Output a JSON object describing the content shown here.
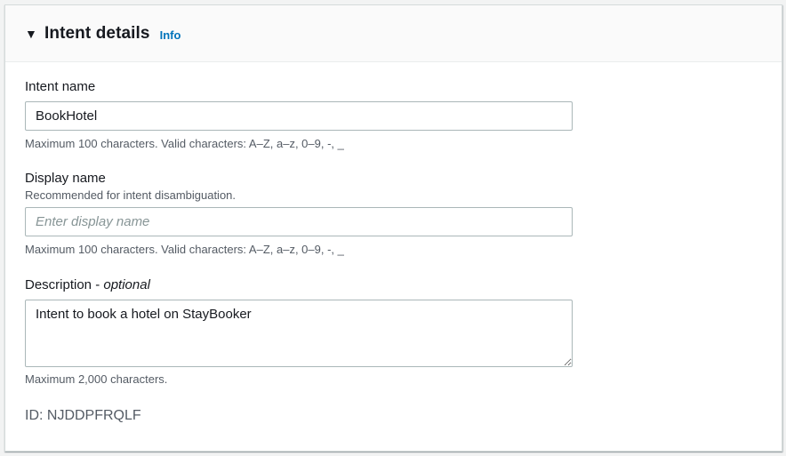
{
  "section": {
    "title": "Intent details",
    "info_label": "Info"
  },
  "intent_name": {
    "label": "Intent name",
    "value": "BookHotel",
    "constraint": "Maximum 100 characters. Valid characters: A–Z, a–z, 0–9, -, _"
  },
  "display_name": {
    "label": "Display name",
    "description": "Recommended for intent disambiguation.",
    "placeholder": "Enter display name",
    "value": "",
    "constraint": "Maximum 100 characters. Valid characters: A–Z, a–z, 0–9, -, _"
  },
  "description": {
    "label": "Description",
    "label_separator": " - ",
    "optional_label": "optional",
    "value": "Intent to book a hotel on StayBooker",
    "constraint": "Maximum 2,000 characters."
  },
  "id_line": "ID: NJDDPFRQLF"
}
